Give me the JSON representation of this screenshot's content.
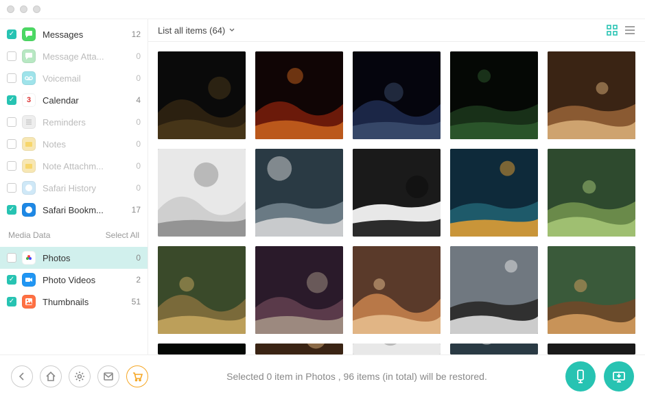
{
  "header": {
    "list_label": "List all items (64)"
  },
  "sidebar": {
    "section1": [
      {
        "label": "Messages",
        "count": 12,
        "checked": true,
        "enabled": true,
        "icon": "messages",
        "color": "#4cd964"
      },
      {
        "label": "Message Atta...",
        "count": 0,
        "checked": false,
        "enabled": false,
        "icon": "messages",
        "color": "#b8e8c3"
      },
      {
        "label": "Voicemail",
        "count": 0,
        "checked": false,
        "enabled": false,
        "icon": "voicemail",
        "color": "#9fe3ea"
      },
      {
        "label": "Calendar",
        "count": 4,
        "checked": true,
        "enabled": true,
        "icon": "calendar",
        "color": "#ffffff"
      },
      {
        "label": "Reminders",
        "count": 0,
        "checked": false,
        "enabled": false,
        "icon": "reminders",
        "color": "#eeeeee"
      },
      {
        "label": "Notes",
        "count": 0,
        "checked": false,
        "enabled": false,
        "icon": "notes",
        "color": "#f7e7b4"
      },
      {
        "label": "Note Attachm...",
        "count": 0,
        "checked": false,
        "enabled": false,
        "icon": "notes",
        "color": "#f7e7b4"
      },
      {
        "label": "Safari History",
        "count": 0,
        "checked": false,
        "enabled": false,
        "icon": "safari",
        "color": "#cfe8f7"
      },
      {
        "label": "Safari Bookm...",
        "count": 17,
        "checked": true,
        "enabled": true,
        "icon": "safari",
        "color": "#1e88e5"
      }
    ],
    "media_header": "Media Data",
    "select_all": "Select All",
    "media": [
      {
        "label": "Photos",
        "count": 0,
        "checked": false,
        "enabled": true,
        "selected": true,
        "icon": "photos",
        "color": "#ffffff"
      },
      {
        "label": "Photo Videos",
        "count": 2,
        "checked": true,
        "enabled": true,
        "icon": "videos",
        "color": "#2196f3"
      },
      {
        "label": "Thumbnails",
        "count": 51,
        "checked": true,
        "enabled": true,
        "icon": "thumbnails",
        "color": "#ff7043"
      }
    ]
  },
  "grid": {
    "thumbs": 15,
    "peek": 5
  },
  "footer": {
    "status": "Selected 0 item in Photos , 96 items (in total) will be restored."
  },
  "colors": {
    "accent": "#27c3b2"
  }
}
